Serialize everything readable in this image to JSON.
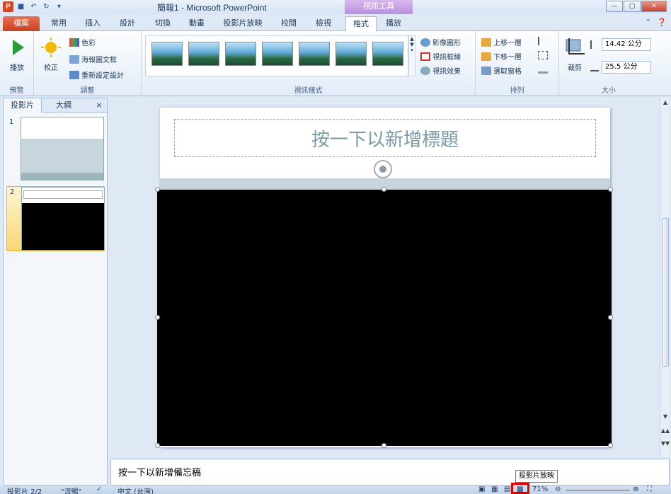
{
  "window": {
    "title": "簡報1 - Microsoft PowerPoint",
    "contextual_tab_group": "視訊工具"
  },
  "tabs": [
    {
      "label": "檔案"
    },
    {
      "label": "常用"
    },
    {
      "label": "插入"
    },
    {
      "label": "設計"
    },
    {
      "label": "切換"
    },
    {
      "label": "動畫"
    },
    {
      "label": "投影片放映"
    },
    {
      "label": "校閱"
    },
    {
      "label": "檢視"
    },
    {
      "label": "格式"
    },
    {
      "label": "播放"
    }
  ],
  "ribbon": {
    "preview": {
      "play_label": "播放",
      "group_label": "預覽"
    },
    "adjust": {
      "corrections_label": "校正",
      "color_label": "色彩",
      "poster_frame_label": "海報圖文框",
      "reset_design_label": "重新設定設計",
      "group_label": "調整"
    },
    "video_styles": {
      "shape_label": "影像圖形",
      "border_label": "視訊框線",
      "effects_label": "視訊效果",
      "group_label": "視訊樣式"
    },
    "arrange": {
      "bring_forward_label": "上移一層",
      "send_backward_label": "下移一層",
      "selection_pane_label": "選取窗格",
      "group_label": "排列"
    },
    "size": {
      "crop_label": "裁剪",
      "height_value": "14.42 公分",
      "width_value": "25.5 公分",
      "group_label": "大小"
    }
  },
  "left_pane": {
    "tab_slides": "投影片",
    "tab_outline": "大綱",
    "close_glyph": "×",
    "slides": [
      {
        "number": "1"
      },
      {
        "number": "2"
      }
    ]
  },
  "slide": {
    "title_placeholder": "按一下以新增標題"
  },
  "notes": {
    "placeholder": "按一下以新增備忘稿"
  },
  "statusbar": {
    "slide_info": "投影片 2/2",
    "theme": "\"流暢\"",
    "language": "中文 (台灣)",
    "zoom": "71%"
  },
  "tooltip": {
    "text": "投影片放映"
  },
  "colors": {
    "file_tab": "#c7401f",
    "video_tools": "#b890e0",
    "highlight": "#e00000"
  }
}
